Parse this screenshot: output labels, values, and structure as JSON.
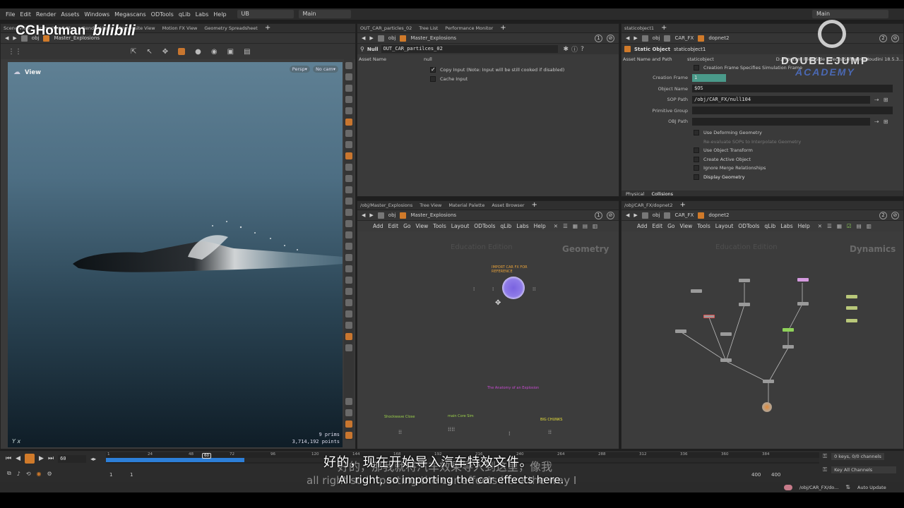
{
  "brand": {
    "channel": "CGHotman",
    "platform": "bilibili",
    "academy_top": "DOUBLEJUMP",
    "academy_bottom": "ACADEMY"
  },
  "menubar": {
    "items": [
      "File",
      "Edit",
      "Render",
      "Assets",
      "Windows",
      "Megascans",
      "ODTools",
      "qLib",
      "Labs",
      "Help"
    ],
    "desktop": "UB",
    "layout": "Main",
    "right_layout": "Main"
  },
  "left_pane": {
    "tabs": [
      "Scene View",
      "Animation Editor",
      "Render View",
      "Composite View",
      "Motion FX View",
      "Geometry Spreadsheet"
    ],
    "path": [
      "obj",
      "Master_Explosions"
    ],
    "viewport_label": "View",
    "persp": "Persp▾",
    "cam": "No cam▾",
    "prims": "9  prims",
    "points": "3,714,192 points",
    "axis": "Y x"
  },
  "mid_top_pane": {
    "tabs": [
      "OUT_CAR_particles_02",
      "Tree List",
      "Performance Monitor"
    ],
    "path": [
      "obj",
      "Master_Explosions"
    ],
    "node_type": "Null",
    "node_name": "OUT_CAR_partilces_02",
    "col_asset": "Asset Name",
    "col_value": "null",
    "options": [
      {
        "label": "Copy Input (Note: Input will be still cooked if disabled)",
        "checked": true
      },
      {
        "label": "Cache Input",
        "checked": false
      }
    ],
    "badge": "1"
  },
  "right_top_pane": {
    "tabs": [
      "staticobject1"
    ],
    "path": [
      "obj",
      "CAR_FX",
      "dopnet2"
    ],
    "node_type": "Static Object",
    "node_name": "staticobject1",
    "col_asset": "Asset Name and Path",
    "col_value": "staticobject",
    "col_path": "D:/Program Files/Side Effects Software/Houdini 18.5.3...",
    "creation_check": "Creation Frame Specifies Simulation Frame",
    "fields": [
      {
        "label": "Creation Frame",
        "value": "1"
      },
      {
        "label": "Object Name",
        "value": "$OS"
      },
      {
        "label": "SOP Path",
        "value": "/obj/CAR_FX/null104"
      },
      {
        "label": "Primitive Group",
        "value": ""
      },
      {
        "label": "OBJ Path",
        "value": ""
      }
    ],
    "checks": [
      "Use Deforming Geometry",
      "Re-evaluate SOPs to Interpolate Geometry",
      "Use Object Transform",
      "Create Active Object",
      "Ignore Merge Relationships",
      "Display Geometry"
    ],
    "bottom_tabs": [
      "Physical",
      "Collisions"
    ],
    "badge": "2"
  },
  "net_left": {
    "tabs": [
      "/obj/Master_Explosions",
      "Tree View",
      "Material Palette",
      "Asset Browser"
    ],
    "path": [
      "obj",
      "Master_Explosions"
    ],
    "menu": [
      "Add",
      "Edit",
      "Go",
      "View",
      "Tools",
      "Layout",
      "ODTools",
      "qLib",
      "Labs",
      "Help"
    ],
    "edition": "Education Edition",
    "context": "Geometry",
    "sticky_note": "IMPORT CAR FX FOR REFERENCE",
    "anatomy": "The Anatomy of an Explosion",
    "groups": [
      "Shockwave Close",
      "main Core Sim",
      "BIG CHUNKS"
    ],
    "badge": "1"
  },
  "net_right": {
    "tabs": [
      "/obj/CAR_FX/dopnet2"
    ],
    "path": [
      "obj",
      "CAR_FX",
      "dopnet2"
    ],
    "menu": [
      "Add",
      "Edit",
      "Go",
      "View",
      "Tools",
      "Layout",
      "ODTools",
      "qLib",
      "Labs",
      "Help"
    ],
    "edition": "Education Edition",
    "context": "Dynamics",
    "badge": "2"
  },
  "timeline": {
    "frame": "60",
    "ticks": [
      "1",
      "24",
      "48",
      "72",
      "96",
      "120",
      "144",
      "168",
      "192",
      "216",
      "240",
      "264",
      "288",
      "312",
      "336",
      "360",
      "384"
    ],
    "current": "60",
    "start": "1",
    "start2": "1",
    "end": "400",
    "end2": "400",
    "keys": "0 keys, 0/0 channels",
    "key_all": "Key All Channels"
  },
  "statusbar": {
    "path": "/obj/CAR_FX/do...",
    "update": "Auto Update"
  },
  "subtitles": {
    "cn": "好的，现在开始导入汽车特效文件。",
    "en": "All right, so importing the car effects here.",
    "ghost_cn": "好的，那我就将汽车效果导入到这里，像我",
    "ghost_en": "all right so importing the car effects here the way I"
  }
}
